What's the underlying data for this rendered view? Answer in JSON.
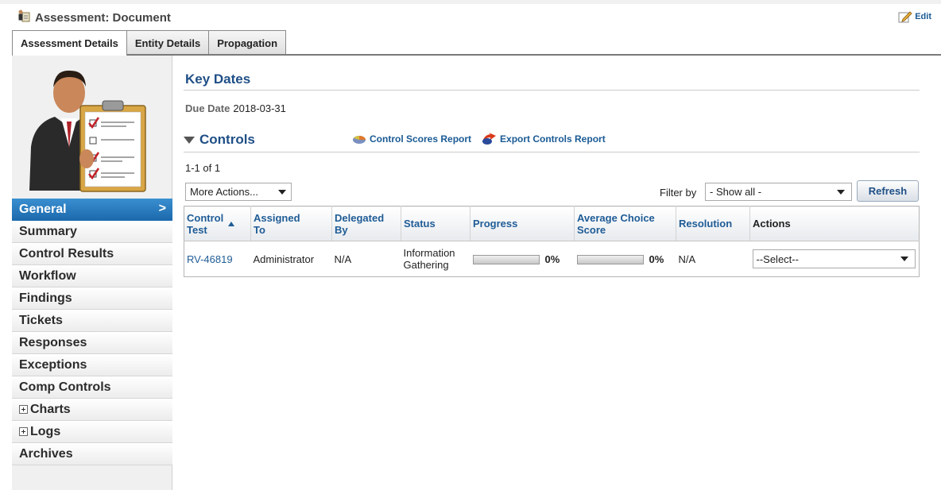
{
  "header": {
    "title": "Assessment: Document",
    "edit_label": "Edit",
    "icon": "assessment-document-icon"
  },
  "tabs": [
    {
      "label": "Assessment Details",
      "active": true
    },
    {
      "label": "Entity Details",
      "active": false
    },
    {
      "label": "Propagation",
      "active": false
    }
  ],
  "sidebar": {
    "items": [
      {
        "label": "General",
        "active": true,
        "expandable": false
      },
      {
        "label": "Summary",
        "active": false,
        "expandable": false
      },
      {
        "label": "Control Results",
        "active": false,
        "expandable": false
      },
      {
        "label": "Workflow",
        "active": false,
        "expandable": false
      },
      {
        "label": "Findings",
        "active": false,
        "expandable": false
      },
      {
        "label": "Tickets",
        "active": false,
        "expandable": false
      },
      {
        "label": "Responses",
        "active": false,
        "expandable": false
      },
      {
        "label": "Exceptions",
        "active": false,
        "expandable": false
      },
      {
        "label": "Comp Controls",
        "active": false,
        "expandable": false
      },
      {
        "label": "Charts",
        "active": false,
        "expandable": true
      },
      {
        "label": "Logs",
        "active": false,
        "expandable": true
      },
      {
        "label": "Archives",
        "active": false,
        "expandable": false
      }
    ],
    "active_chevron": ">"
  },
  "key_dates": {
    "title": "Key Dates",
    "due_date_label": "Due Date",
    "due_date_value": "2018-03-31"
  },
  "controls": {
    "title": "Controls",
    "control_scores_report": "Control Scores Report",
    "export_controls_report": "Export Controls Report",
    "count_text": "1-1 of 1",
    "more_actions": "More Actions...",
    "filter_label": "Filter by",
    "filter_value": "- Show all -",
    "refresh_label": "Refresh",
    "columns": {
      "control_test": "Control Test",
      "assigned_to": "Assigned To",
      "delegated_by": "Delegated By",
      "status": "Status",
      "progress": "Progress",
      "average_choice_score": "Average Choice Score",
      "resolution": "Resolution",
      "actions": "Actions"
    },
    "rows": [
      {
        "control_test": "RV-46819",
        "assigned_to": "Administrator",
        "delegated_by": "N/A",
        "status": "Information Gathering",
        "progress_pct": 0,
        "progress_text": "0%",
        "avg_score_pct": 0,
        "avg_score_text": "0%",
        "resolution": "N/A",
        "action_value": "--Select--"
      }
    ]
  },
  "colors": {
    "accent": "#1f5c96",
    "active_nav": "#2a7cc0",
    "title_blue": "#1f4f86"
  }
}
